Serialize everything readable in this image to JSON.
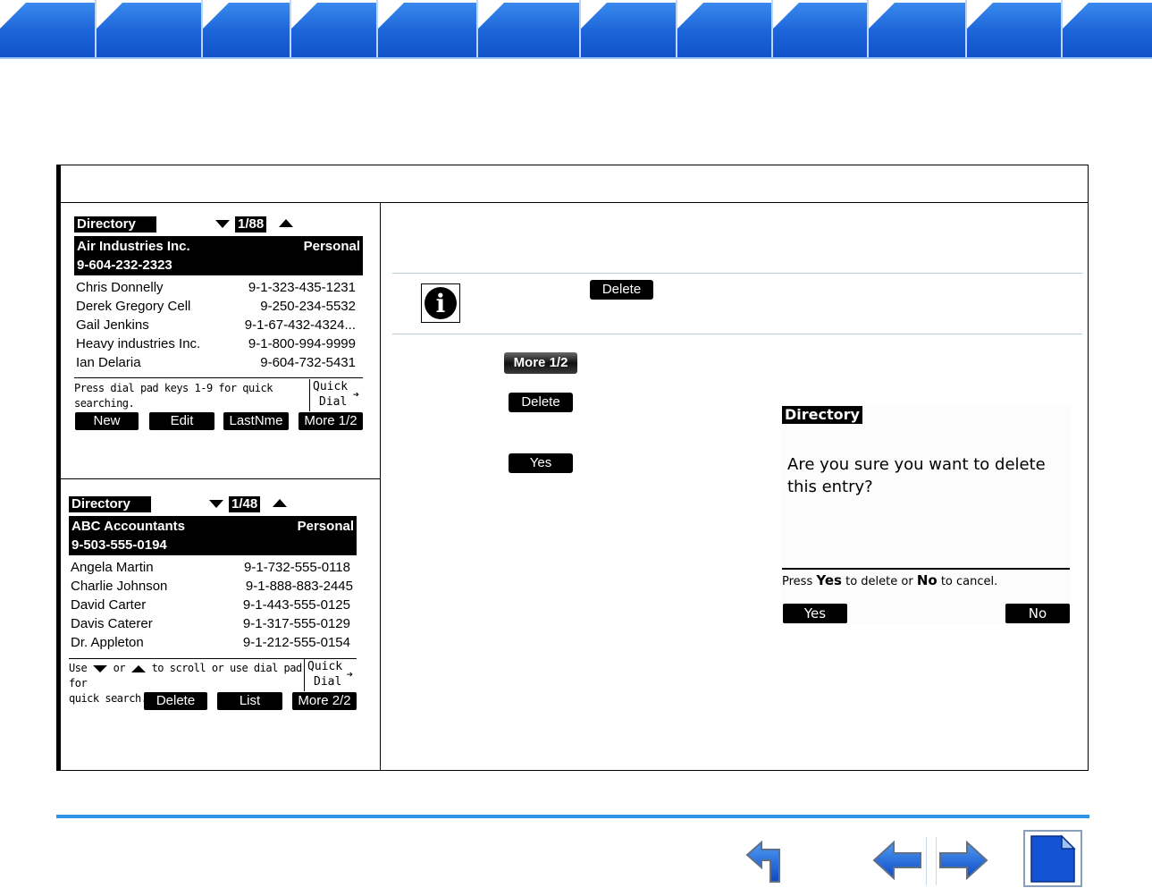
{
  "topbar": {
    "tabs": [
      {
        "id": "tab-1"
      },
      {
        "id": "tab-2"
      },
      {
        "id": "tab-3"
      },
      {
        "id": "tab-4"
      },
      {
        "id": "tab-5"
      },
      {
        "id": "tab-6"
      },
      {
        "id": "tab-7"
      },
      {
        "id": "tab-8"
      },
      {
        "id": "tab-9"
      },
      {
        "id": "tab-10"
      },
      {
        "id": "tab-11"
      },
      {
        "id": "tab-12"
      }
    ],
    "color": "#1b63d8"
  },
  "screen1": {
    "title": "Directory",
    "count": "1/88",
    "selected": {
      "name": "Air Industries Inc.",
      "type": "Personal",
      "number": "9-604-232-2323"
    },
    "entries": [
      {
        "name": "Chris Donnelly",
        "number": "9-1-323-435-1231"
      },
      {
        "name": "Derek Gregory Cell",
        "number": "9-250-234-5532"
      },
      {
        "name": "Gail Jenkins",
        "number": "9-1-67-432-4324..."
      },
      {
        "name": "Heavy industries Inc.",
        "number": "9-1-800-994-9999"
      },
      {
        "name": "Ian Delaria",
        "number": "9-604-732-5431"
      }
    ],
    "hint_line1": "Press dial pad keys 1-9 for quick",
    "hint_line2": "searching.",
    "quick": "Quick",
    "dial": "Dial",
    "softkeys": [
      "New",
      "Edit",
      "LastNme",
      "More 1/2"
    ]
  },
  "screen2": {
    "title": "Directory",
    "count": "1/48",
    "selected": {
      "name": "ABC Accountants",
      "type": "Personal",
      "number": "9-503-555-0194"
    },
    "entries": [
      {
        "name": "Angela Martin",
        "number": "9-1-732-555-0118"
      },
      {
        "name": "Charlie Johnson",
        "number": "9-1-888-883-2445"
      },
      {
        "name": "David Carter",
        "number": "9-1-443-555-0125"
      },
      {
        "name": "Davis Caterer",
        "number": "9-1-317-555-0129"
      },
      {
        "name": "Dr. Appleton",
        "number": "9-1-212-555-0154"
      }
    ],
    "hint_use": "Use",
    "hint_or": "or",
    "hint_rest": "to scroll or use dial pad for",
    "hint_line2": "quick search.",
    "quick": "Quick",
    "dial": "Dial",
    "softkeys": [
      "Delete",
      "List",
      "More 2/2"
    ]
  },
  "right": {
    "note_button": "Delete",
    "step1_button": "More 1/2",
    "step2_button": "Delete",
    "step3_button": "Yes"
  },
  "dialog": {
    "title": "Directory",
    "message": "Are you sure you want to delete this entry?",
    "hint_press": "Press",
    "hint_yes": "Yes",
    "hint_mid": "to delete or",
    "hint_no": "No",
    "hint_end": "to cancel.",
    "yes": "Yes",
    "no": "No"
  },
  "footer": {
    "nav": [
      "back-icon",
      "previous-page-icon",
      "next-page-icon",
      "document-icon"
    ],
    "accent": "#2f93ea"
  }
}
